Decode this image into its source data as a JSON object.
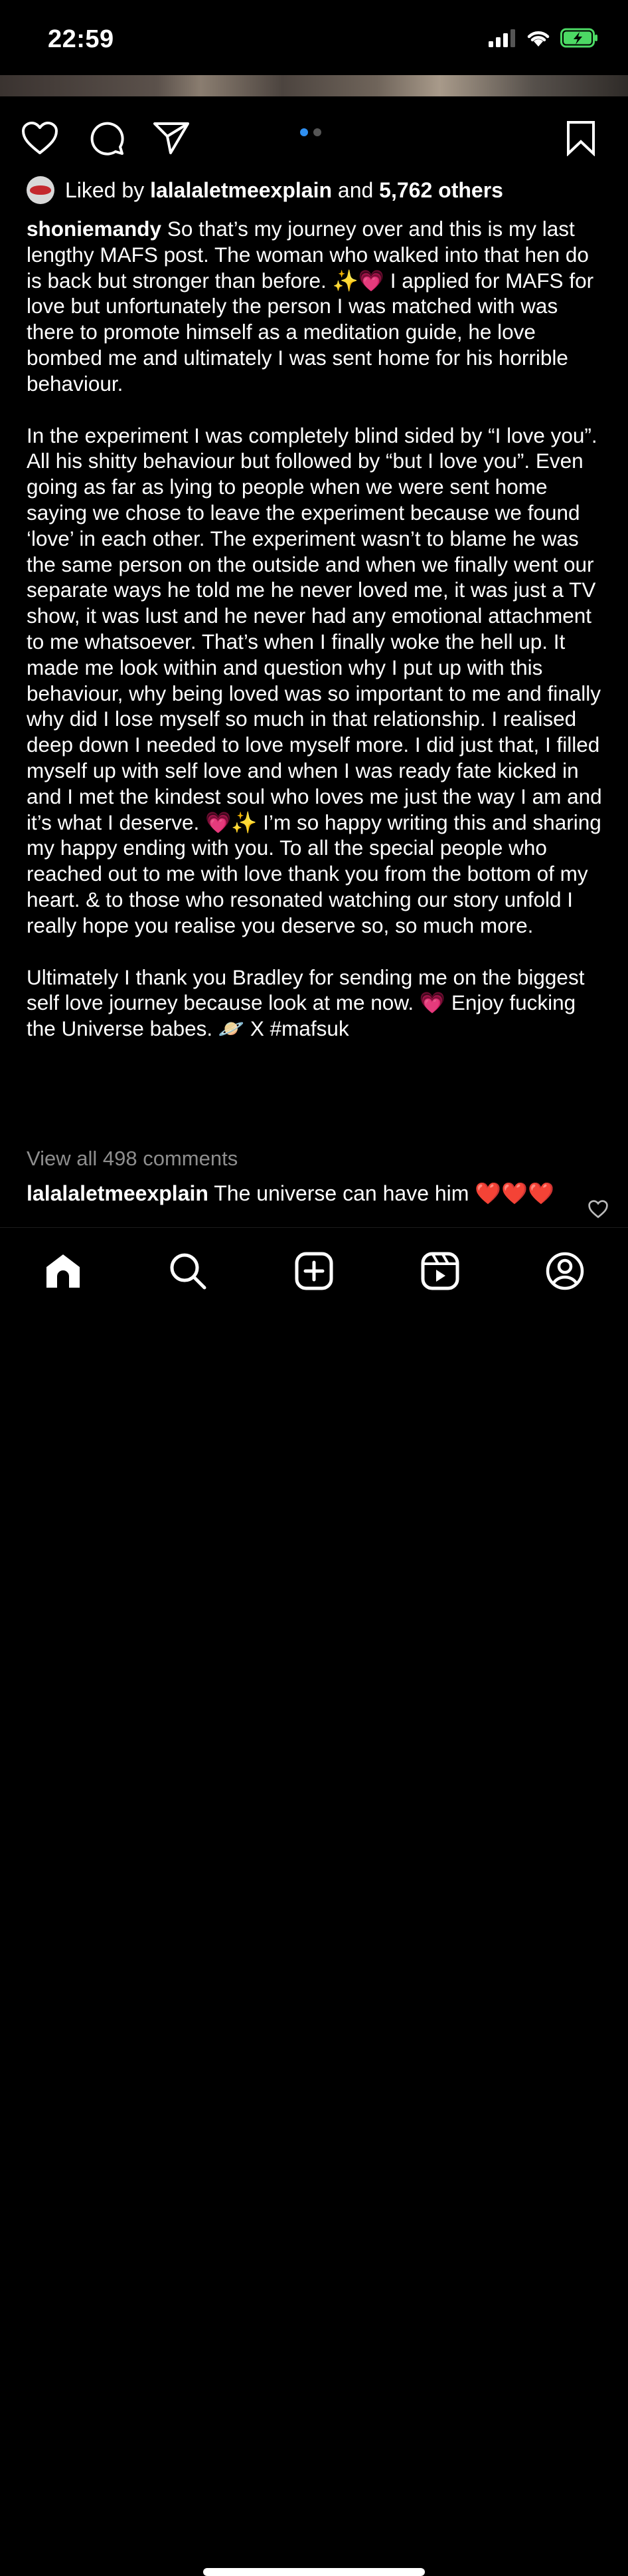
{
  "status": {
    "time": "22:59"
  },
  "post": {
    "pagination": {
      "total": 2,
      "active": 0
    },
    "likes": {
      "prefix": "Liked by",
      "user": "lalalaletmeexplain",
      "middle": "and",
      "others": "5,762 others"
    },
    "caption": {
      "username": "shoniemandy",
      "paragraphs": [
        "So that’s my journey over and this is my last lengthy MAFS post. The woman who walked into that hen do is back but stronger than before. ✨💗 I applied for MAFS for love but unfortunately the person I was matched with was there to promote himself as a meditation guide, he love bombed me and ultimately I was sent home for his horrible behaviour.",
        "In the experiment I was completely blind sided by “I love you”. All his shitty behaviour but followed by “but I love you”. Even going as far as lying to people when we were sent home saying we chose to leave the experiment because we found ‘love’ in each other. The experiment wasn’t to blame he was the same person on the outside and when we finally went our separate ways he told me he never loved me, it was just a TV show, it was lust and he never had any emotional attachment to me whatsoever. That’s when I finally woke the hell up. It made me look within and question why I put up with this behaviour, why being loved was so important to me and finally why did I lose myself so much in that relationship. I realised deep down I needed to love myself more. I did just that, I filled myself up with self love and when I was ready fate kicked in and I met the kindest soul who loves me just the way I am and it’s what I deserve. 💗✨ I’m so happy writing this and sharing my happy ending with you. To all the special people who reached out to me with love thank you from the bottom of my heart. & to those who resonated watching our story unfold I really hope you realise you deserve so, so much more.",
        "Ultimately I thank you Bradley for sending me on the biggest self love journey because look at me now. 💗 Enjoy fucking the Universe babes. 🪐 X #mafsuk"
      ]
    },
    "view_all_comments": "View all 498 comments",
    "top_comment": {
      "username": "lalalaletmeexplain",
      "text": "The universe can have him ❤️❤️❤️"
    }
  },
  "icons": {
    "like": "heart-icon",
    "comment": "comment-bubble-icon",
    "share": "paper-plane-icon",
    "save": "bookmark-icon",
    "tabs": [
      "home-icon",
      "search-icon",
      "create-post-icon",
      "reels-icon",
      "profile-icon"
    ]
  },
  "colors": {
    "active_dot": "#2f8ff0",
    "muted_text": "#8e8e8e",
    "battery": "#4cd964"
  }
}
